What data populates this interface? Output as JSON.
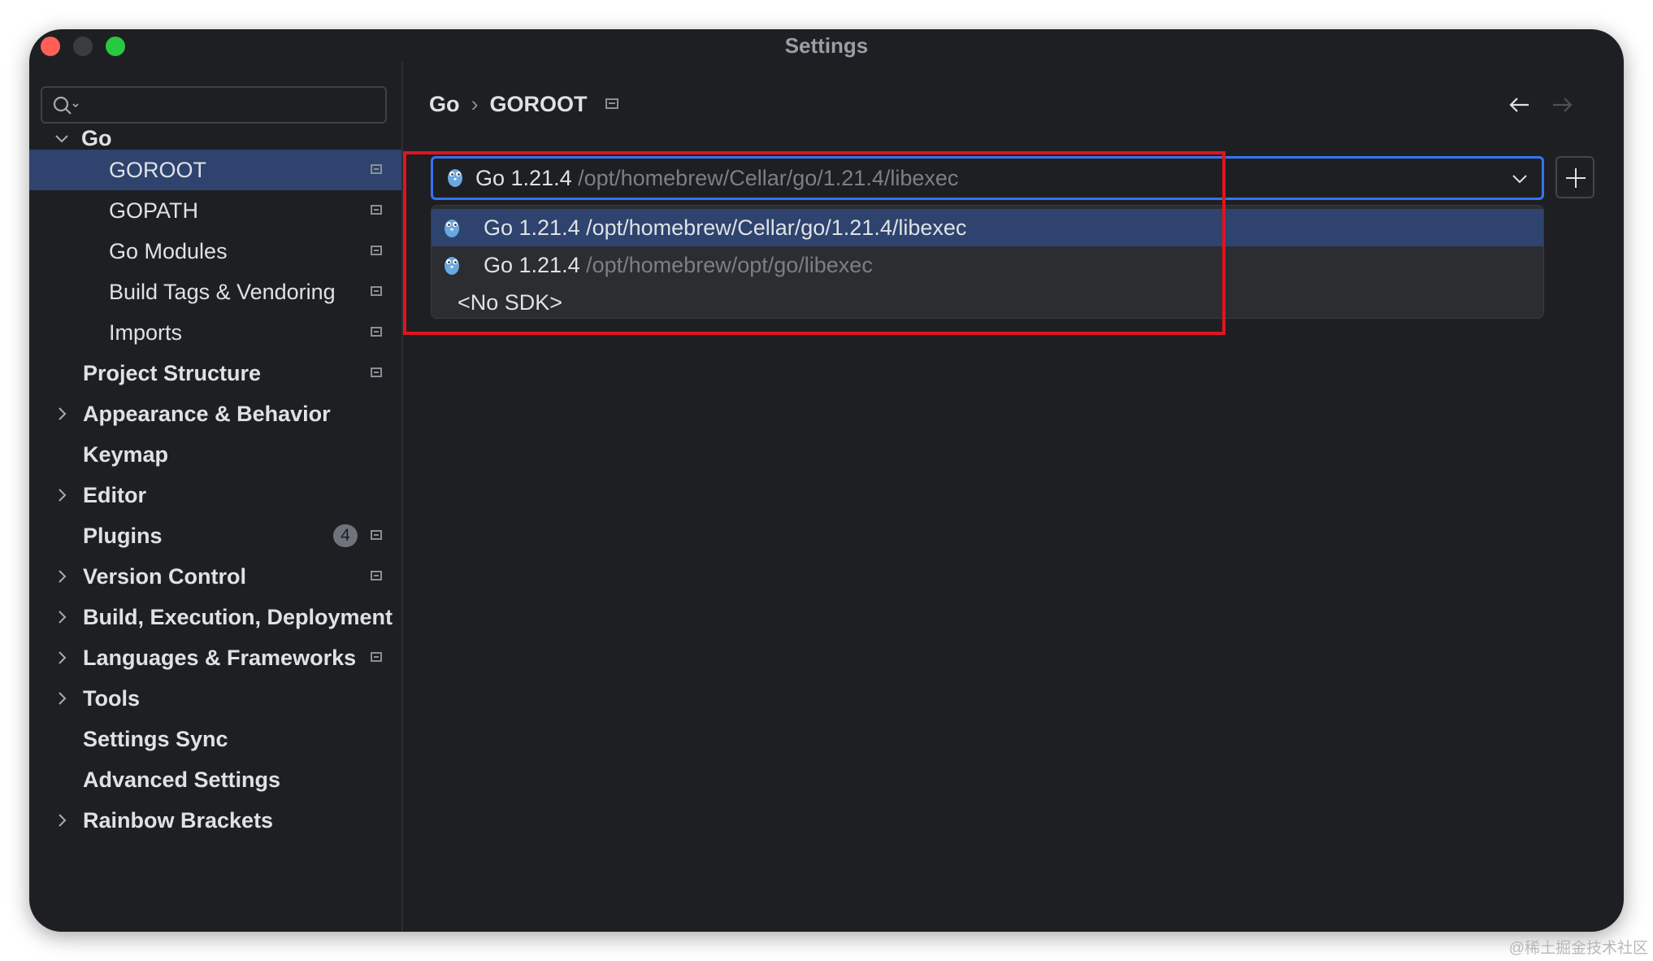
{
  "window": {
    "title": "Settings"
  },
  "search": {
    "placeholder": "",
    "icon": "search-icon"
  },
  "sidebar": {
    "items": [
      {
        "label": "Go",
        "expanded": true
      },
      {
        "label": "GOROOT",
        "selected": true
      },
      {
        "label": "GOPATH"
      },
      {
        "label": "Go Modules"
      },
      {
        "label": "Build Tags & Vendoring"
      },
      {
        "label": "Imports"
      },
      {
        "label": "Project Structure"
      },
      {
        "label": "Appearance & Behavior"
      },
      {
        "label": "Keymap"
      },
      {
        "label": "Editor"
      },
      {
        "label": "Plugins",
        "badge": "4"
      },
      {
        "label": "Version Control"
      },
      {
        "label": "Build, Execution, Deployment"
      },
      {
        "label": "Languages & Frameworks"
      },
      {
        "label": "Tools"
      },
      {
        "label": "Settings Sync"
      },
      {
        "label": "Advanced Settings"
      },
      {
        "label": "Rainbow Brackets"
      }
    ]
  },
  "breadcrumb": {
    "parent": "Go",
    "separator": "›",
    "current": "GOROOT"
  },
  "sdk": {
    "selected_version": "Go 1.21.4",
    "selected_path": "/opt/homebrew/Cellar/go/1.21.4/libexec",
    "options": [
      {
        "version": "Go 1.21.4",
        "path": "/opt/homebrew/Cellar/go/1.21.4/libexec"
      },
      {
        "version": "Go 1.21.4",
        "path": "/opt/homebrew/opt/go/libexec"
      },
      {
        "label": "<No SDK>"
      }
    ]
  },
  "colors": {
    "window_bg": "#1e1f22",
    "selection": "#2e436e",
    "accent_border": "#3574f0",
    "annotation_red": "#e0141e",
    "close": "#ff5f57",
    "maximize": "#28c840"
  },
  "watermark": "@稀土掘金技术社区"
}
